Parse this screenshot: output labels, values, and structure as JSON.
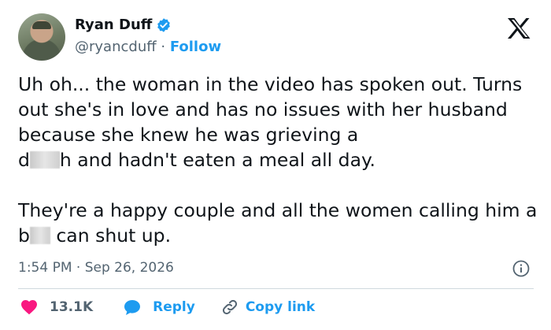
{
  "author": {
    "display_name": "Ryan Duff",
    "handle": "@ryancduff",
    "separator": "·",
    "follow_label": "Follow"
  },
  "tweet": {
    "line1": "Uh oh... the woman in the video has spoken out. Turns out she's in love and has no issues with her husband because she knew he was grieving a",
    "line1_censored_prefix": "d",
    "line1_after": "h and hadn't eaten a meal all day.",
    "para2_before": "They're a happy couple and all the women calling him a b",
    "para2_after": " can shut up."
  },
  "timestamp": "1:54 PM · Sep 26, 2026",
  "actions": {
    "likes": "13.1K",
    "reply_label": "Reply",
    "copy_link_label": "Copy link"
  },
  "colors": {
    "accent": "#1d9bf0",
    "like": "#f91880",
    "text": "#0f1419",
    "muted": "#536471"
  }
}
